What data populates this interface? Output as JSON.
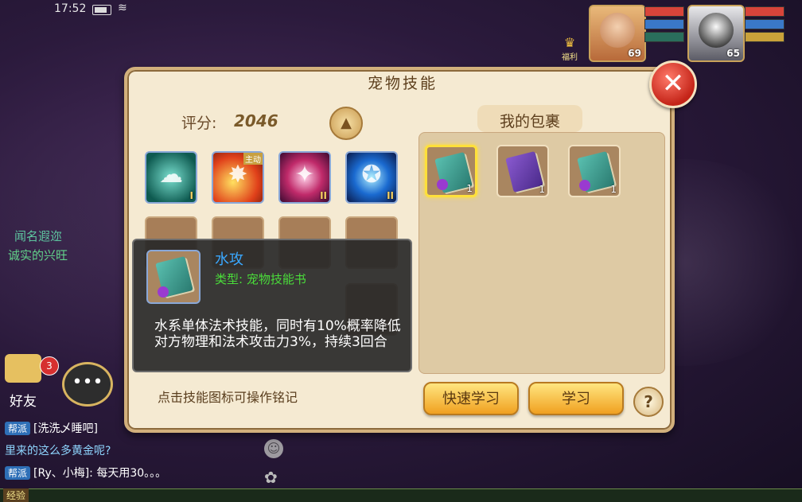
{
  "status_bar": {
    "time": "17:52"
  },
  "portraits": [
    {
      "level": "69"
    },
    {
      "level": "65"
    }
  ],
  "fuli_label": "福利",
  "side_texts": [
    "闻名遐迩",
    "诚实的兴旺"
  ],
  "friends": {
    "label": "好友",
    "badge": "3"
  },
  "chat": [
    {
      "tag": "帮派",
      "text": "[洗洗乄睡吧]"
    },
    {
      "text": "里来的这么多黄金呢?"
    },
    {
      "tag": "帮派",
      "text": "[Ry、小梅]: 每天用30。。。"
    }
  ],
  "exp_label": "经验",
  "panel": {
    "title": "宠物技能",
    "score_label": "评分:",
    "score_value": "2046",
    "hint": "点击技能图标可操作铭记"
  },
  "skills": [
    {
      "tier": "I"
    },
    {
      "tag": "主动"
    },
    {
      "tier": "II"
    },
    {
      "tier": "II"
    }
  ],
  "tooltip": {
    "name": "水攻",
    "type": "类型: 宠物技能书",
    "description": "水系单体法术技能，同时有10%概率降低对方物理和法术攻击力3%，持续3回合"
  },
  "bag": {
    "title": "我的包裹",
    "items": [
      {
        "count": "1"
      },
      {
        "count": "1"
      },
      {
        "count": "1"
      }
    ]
  },
  "buttons": {
    "quick_learn": "快速学习",
    "learn": "学习",
    "help": "?"
  },
  "icons": {
    "close": "close-icon",
    "up": "arrow-up-icon",
    "chat": "chat-bubble-icon"
  }
}
